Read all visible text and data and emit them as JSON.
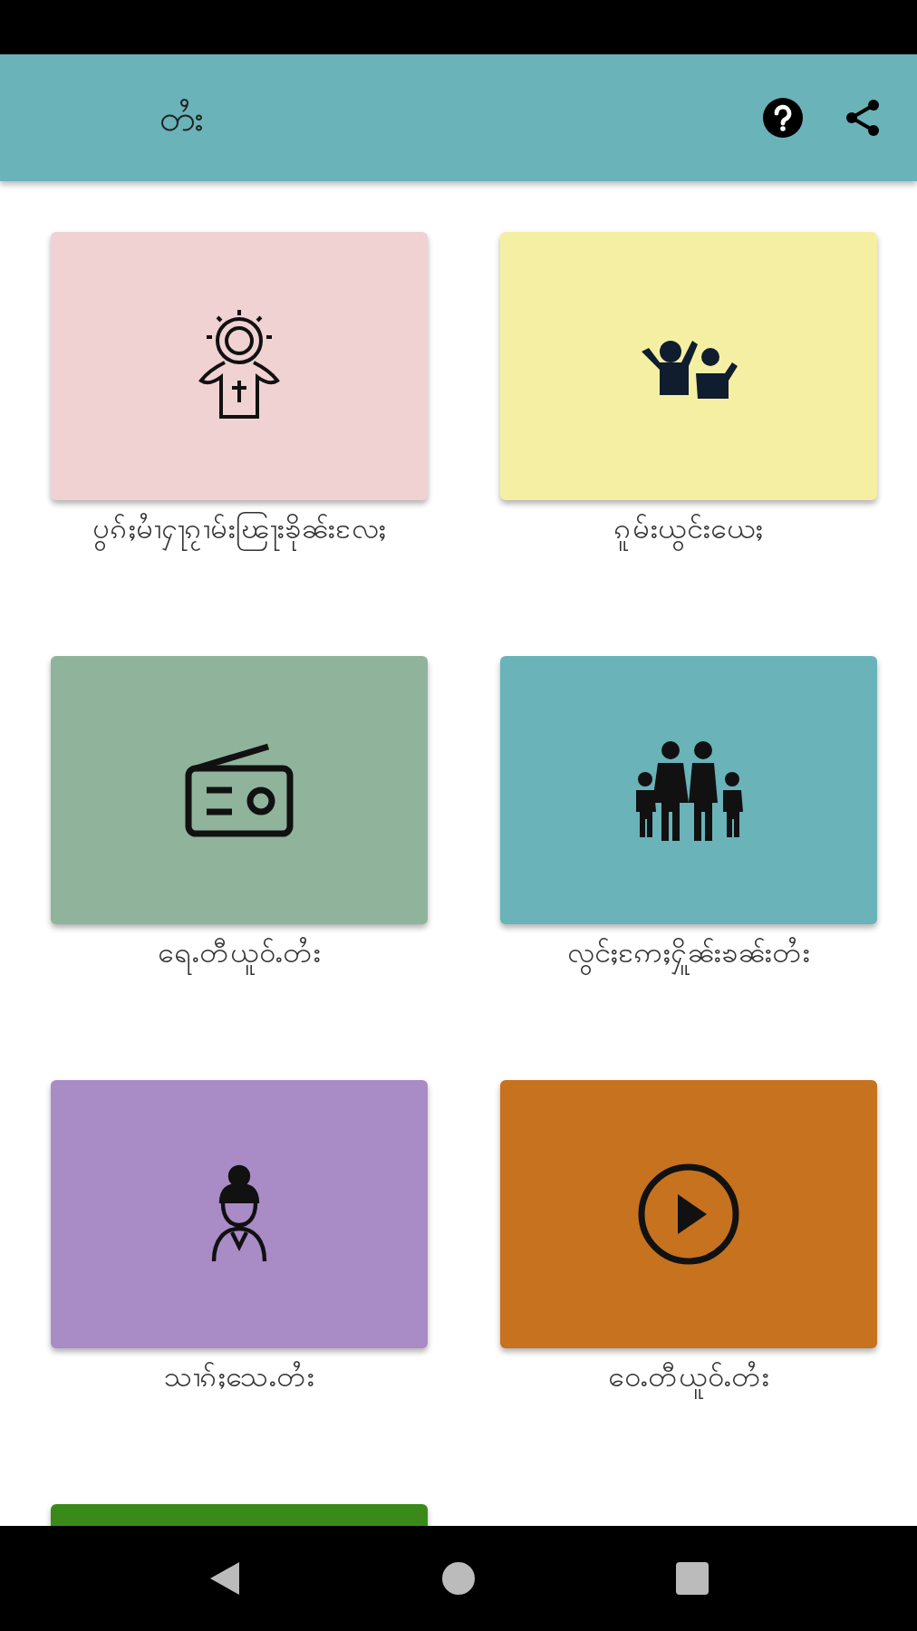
{
  "app_bar": {
    "title": "တႆး"
  },
  "cards": [
    {
      "label": "ပွၵ်ႈမၢႆႁႃၵႂၢမ်းၽြႃးၶိုၼ်းလႄႈ",
      "color": "#f0d2d2",
      "kind": "halo"
    },
    {
      "label": "ၵူမ်းယွင်းယေႈ",
      "color": "#f5efa3",
      "kind": "cheer"
    },
    {
      "label": "ရေႉတီယူဝ်ႉတႆး",
      "color": "#8fb39b",
      "kind": "radio"
    },
    {
      "label": "လွင်ႈဢႄႈႁိူၼ်းၶၼ်းတႆး",
      "color": "#69b3b9",
      "kind": "family"
    },
    {
      "label": "သၢၵ်ႈသေႉတႆး",
      "color": "#a98bc6",
      "kind": "woman"
    },
    {
      "label": "ဝေႉတီယူဝ်ႉတႆး",
      "color": "#c6721f",
      "kind": "play"
    },
    {
      "color": "#3a8a1a"
    }
  ]
}
